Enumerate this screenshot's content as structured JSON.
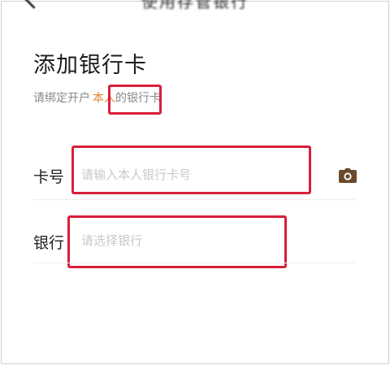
{
  "nav": {
    "title": "使用存管银行"
  },
  "page": {
    "title": "添加银行卡",
    "subtitle_prefix": "请绑定开户",
    "subtitle_highlight": "本人",
    "subtitle_suffix": "的银行卡"
  },
  "form": {
    "card_number": {
      "label": "卡号",
      "placeholder": "请输入本人银行卡号",
      "value": ""
    },
    "bank": {
      "label": "银行",
      "placeholder": "请选择银行",
      "value": ""
    }
  },
  "icons": {
    "back": "chevron-left-icon",
    "camera": "camera-icon"
  },
  "colors": {
    "highlight": "#e0812c",
    "annotation": "#d81e3a",
    "camera": "#6b4a2c"
  }
}
